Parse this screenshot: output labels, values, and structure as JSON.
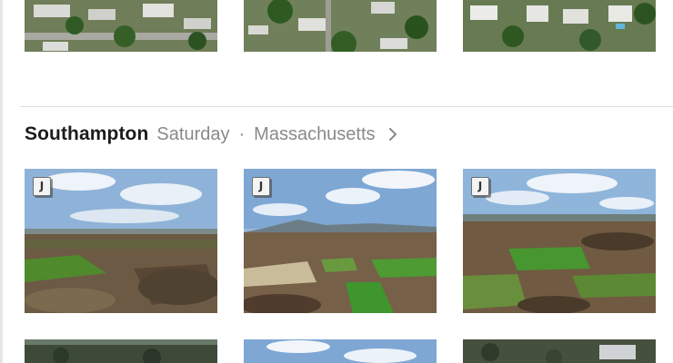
{
  "section": {
    "title": "Southampton",
    "date": "Saturday",
    "separator": "·",
    "location": "Massachusetts",
    "chevron_icon": "chevron-right-icon"
  },
  "badge": {
    "label": "J",
    "icon": "jpeg-badge-icon"
  },
  "colors": {
    "title": "#1c1c1c",
    "subtitle": "#8a8a8a",
    "divider": "#dcdcdc"
  }
}
